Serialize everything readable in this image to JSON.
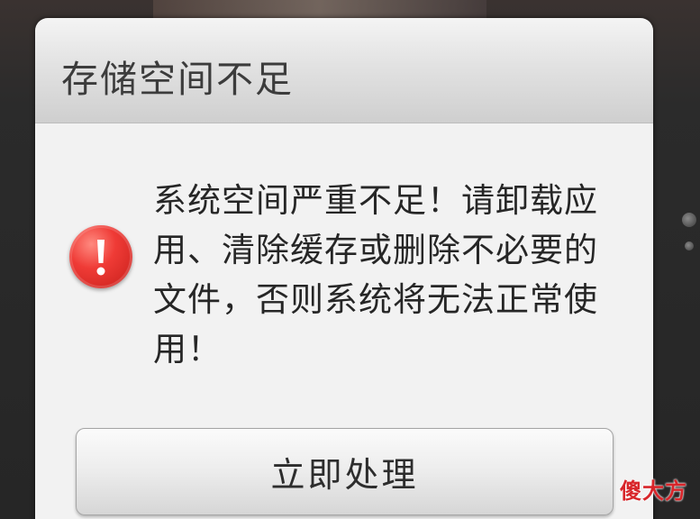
{
  "dialog": {
    "title": "存储空间不足",
    "message": "系统空间严重不足！请卸载应用、清除缓存或删除不必要的文件，否则系统将无法正常使用！",
    "icon": "warning-icon",
    "button_label": "立即处理"
  },
  "watermark": {
    "text": "傻大方"
  },
  "colors": {
    "warning_red": "#e53935",
    "watermark_red": "#d8252a"
  }
}
